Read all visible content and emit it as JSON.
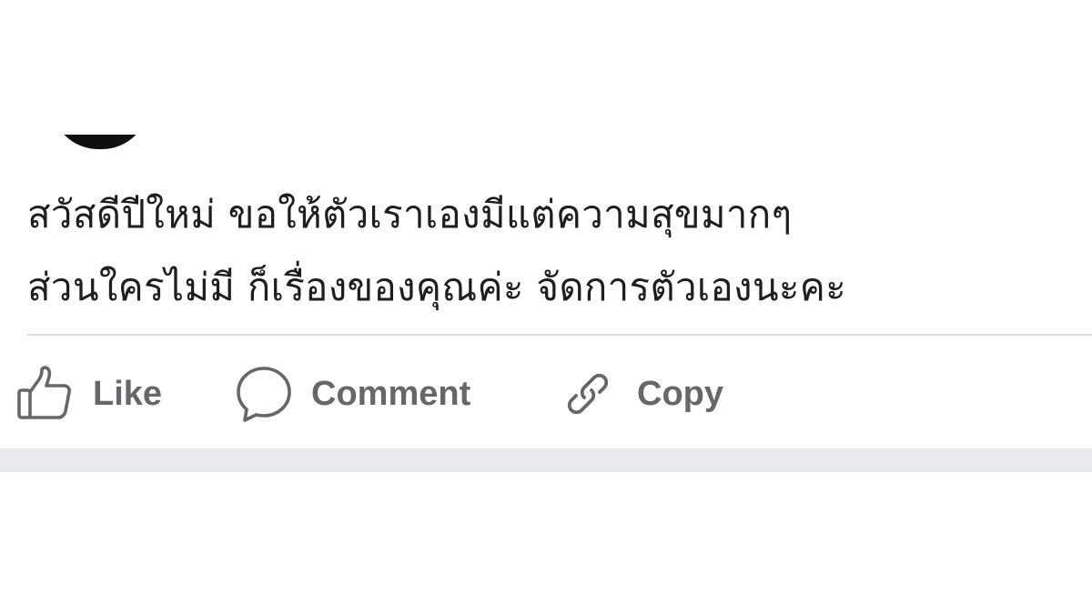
{
  "post": {
    "text_lines": [
      "สวัสดีปีใหม่ ขอให้ตัวเราเองมีแต่ความสุขมากๆ",
      "ส่วนใครไม่มี ก็เรื่องของคุณค่ะ จัดการตัวเองนะคะ"
    ]
  },
  "actions": {
    "like": {
      "label": "Like",
      "icon": "thumbs-up-icon"
    },
    "comment": {
      "label": "Comment",
      "icon": "speech-bubble-icon"
    },
    "copy": {
      "label": "Copy",
      "icon": "link-icon"
    }
  },
  "colors": {
    "text": "#1c1e21",
    "action_gray": "#65676b",
    "divider": "#dadde1",
    "separator_band": "#e8e9ed"
  }
}
